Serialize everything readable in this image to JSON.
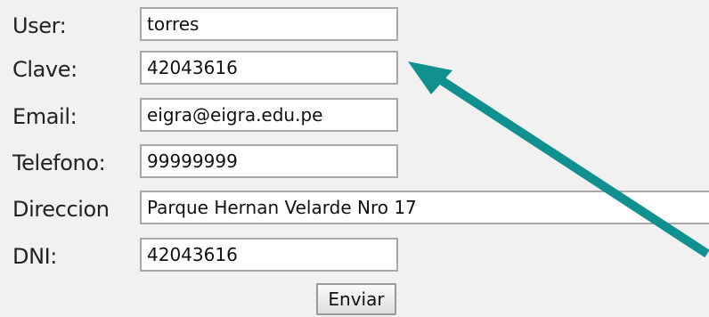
{
  "form": {
    "fields": [
      {
        "label": "User:",
        "value": "torres"
      },
      {
        "label": "Clave:",
        "value": "42043616"
      },
      {
        "label": "Email:",
        "value": "eigra@eigra.edu.pe"
      },
      {
        "label": "Telefono:",
        "value": "99999999"
      },
      {
        "label": "Direccion",
        "value": "Parque Hernan Velarde Nro 17"
      },
      {
        "label": "DNI:",
        "value": "42043616"
      }
    ],
    "submit_label": "Enviar"
  },
  "colors": {
    "background": "#f1f1f1",
    "field_border": "#a8a8a8",
    "annotation_arrow": "#119090"
  },
  "annotation": {
    "icon": "pointer-arrow-icon"
  }
}
